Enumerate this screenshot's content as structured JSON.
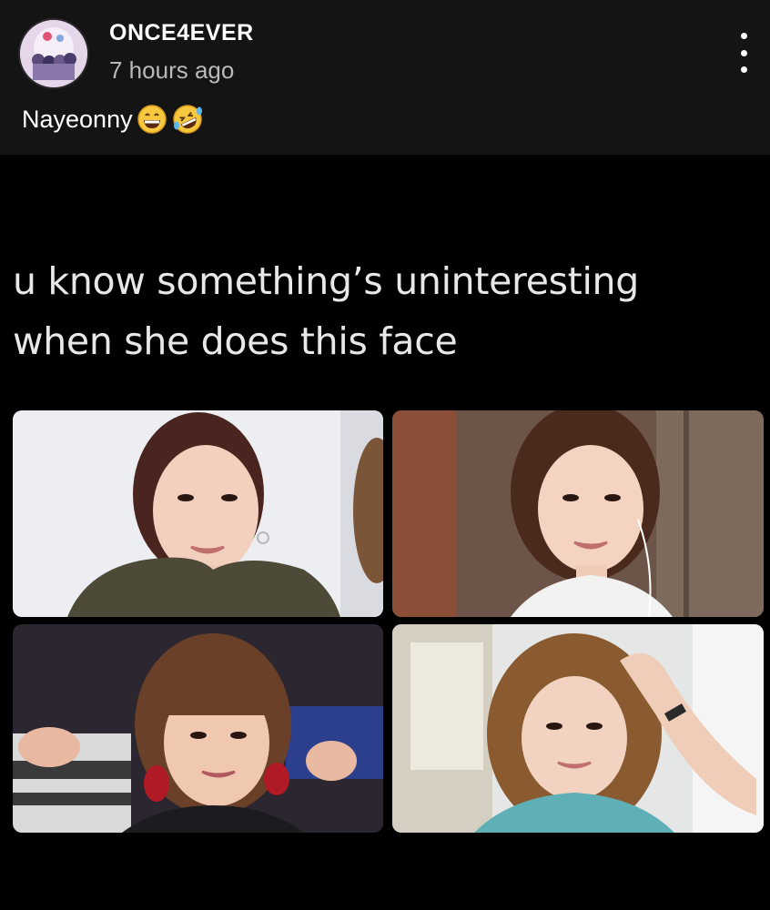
{
  "post": {
    "username": "ONCE4EVER",
    "timestamp": "7 hours ago",
    "caption": "Nayeonny",
    "caption_emojis": [
      "grinning-face-emoji",
      "rolling-on-floor-laughing-emoji"
    ],
    "more_icon": "vertical-ellipsis-icon"
  },
  "meme": {
    "text_line_1": "u know something’s uninteresting",
    "text_line_2": "when she does this face",
    "photos": [
      {
        "name": "photo-smiling-top-left"
      },
      {
        "name": "photo-smiling-top-right"
      },
      {
        "name": "photo-smiling-bottom-left"
      },
      {
        "name": "photo-smiling-bottom-right"
      }
    ]
  },
  "colors": {
    "background": "#121212",
    "meme_background": "#000000",
    "timestamp": "#b9b9b9",
    "text": "#ffffff"
  }
}
